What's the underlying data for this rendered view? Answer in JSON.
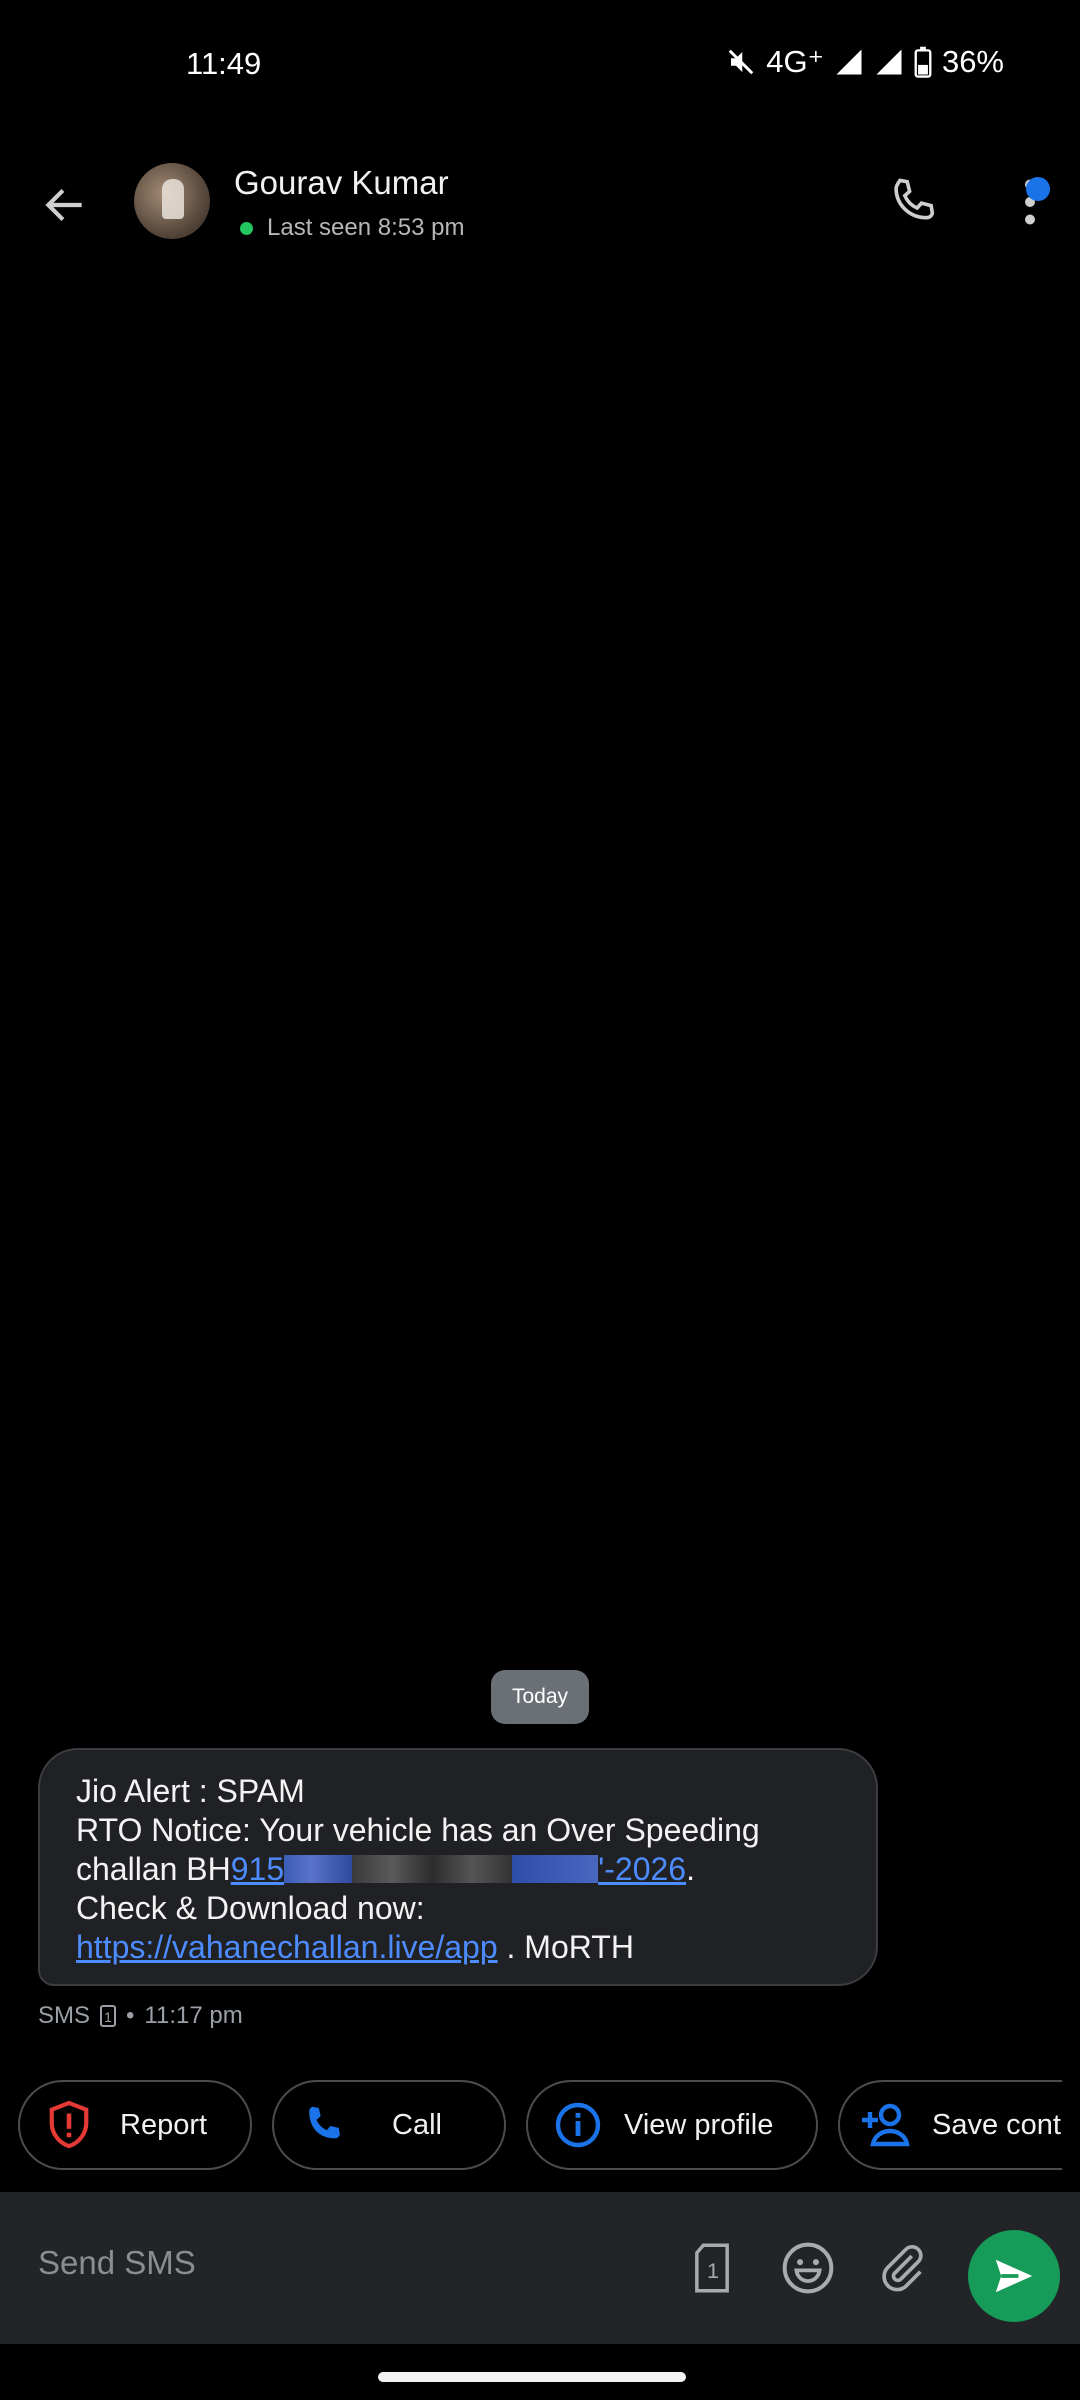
{
  "status_bar": {
    "time": "11:49",
    "network": "4G⁺",
    "battery": "36%",
    "icons": [
      "mute-icon",
      "signal-icon",
      "signal-icon",
      "battery-icon"
    ]
  },
  "header": {
    "back_icon": "arrow-left-icon",
    "contact_name": "Gourav Kumar",
    "presence": "Last seen 8:53 pm",
    "presence_color": "#22c55e",
    "call_icon": "phone-icon",
    "more_icon": "more-vertical-icon",
    "notification_color": "#1a73e8"
  },
  "conversation": {
    "date_chip": "Today",
    "message": {
      "line1": "Jio Alert : SPAM",
      "line2": "RTO Notice: Your vehicle has an Over Speeding",
      "line3_prefix": "challan BH",
      "line3_link_start": "915",
      "line3_link_end": "'-2026",
      "line3_suffix": ".",
      "line4": "Check & Download now:",
      "line5_link": "https://vahanechallan.live/app",
      "line5_suffix": " . MoRTH"
    },
    "meta": {
      "channel": "SMS",
      "sim": "1",
      "separator": "•",
      "time": "11:17 pm"
    }
  },
  "actions": [
    {
      "label": "Report",
      "icon": "shield-alert-icon",
      "color": "#e53935"
    },
    {
      "label": "Call",
      "icon": "phone-icon",
      "color": "#1a73e8"
    },
    {
      "label": "View profile",
      "icon": "info-icon",
      "color": "#1a73e8"
    },
    {
      "label": "Save cont",
      "icon": "person-add-icon",
      "color": "#1a73e8"
    }
  ],
  "composer": {
    "placeholder": "Send SMS",
    "sim_label": "1",
    "icons": [
      "sim-icon",
      "emoji-icon",
      "attach-icon",
      "send-icon"
    ],
    "send_color": "#169b58"
  }
}
